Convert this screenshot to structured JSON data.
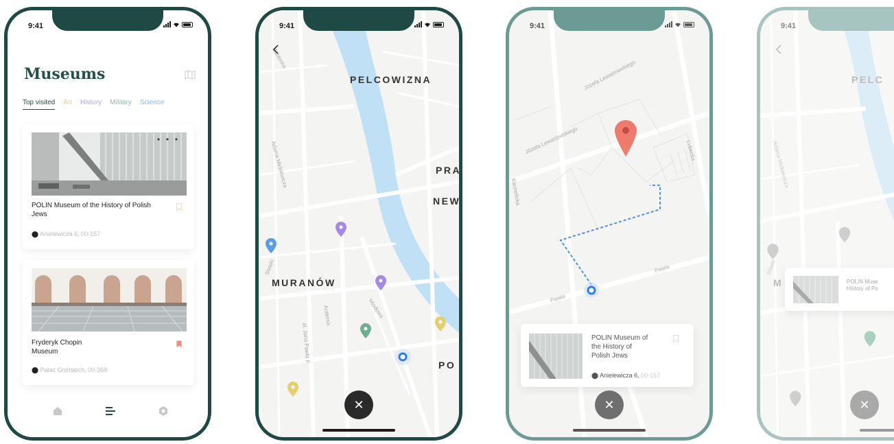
{
  "status": {
    "time": "9:41"
  },
  "museums_screen": {
    "title": "Museums",
    "tabs": [
      "Top visited",
      "Art",
      "History",
      "Military",
      "Science"
    ],
    "cards": [
      {
        "name": "POLIN Museum of the History of Polish Jews",
        "address": "Anielewicza 6, 00-157"
      },
      {
        "name": "Fryderyk Chopin Museum",
        "address": "Pałac Gnińskich, 00-368"
      }
    ]
  },
  "map_screen": {
    "districts": [
      "PELCOWIZNA",
      "PRA",
      "NEW",
      "MURANÓW",
      "PO"
    ],
    "streets": [
      "Stawki",
      "Adama Mickiewicza",
      "Andersa",
      "Miodowa",
      "al. Jana Pawła II",
      "Zabłocka"
    ],
    "close_label": "✕"
  },
  "route_screen": {
    "streets": [
      "Józefa Lewartowskiego",
      "Karmelicka",
      "Pawia",
      "Lubecka"
    ],
    "card": {
      "name_line1": "POLIN Museum of",
      "name_line2": "the History of",
      "name_line3": "Polish Jews",
      "address": "Anielewicza 6,",
      "address_rest": "00-157"
    },
    "close_label": "✕"
  },
  "partial_screen": {
    "district": "PELC",
    "district2": "M",
    "card": {
      "name_line1": "POLIN Muse",
      "name_line2": "History of Po"
    },
    "close_label": "✕"
  },
  "colors": {
    "brand": "#1f4a43",
    "art": "#f0c98a",
    "history": "#a9a8e0",
    "military": "#8fb8b2",
    "science": "#8ab5ef",
    "river": "#bfe0f5",
    "pin_red": "#ef7b6e"
  }
}
